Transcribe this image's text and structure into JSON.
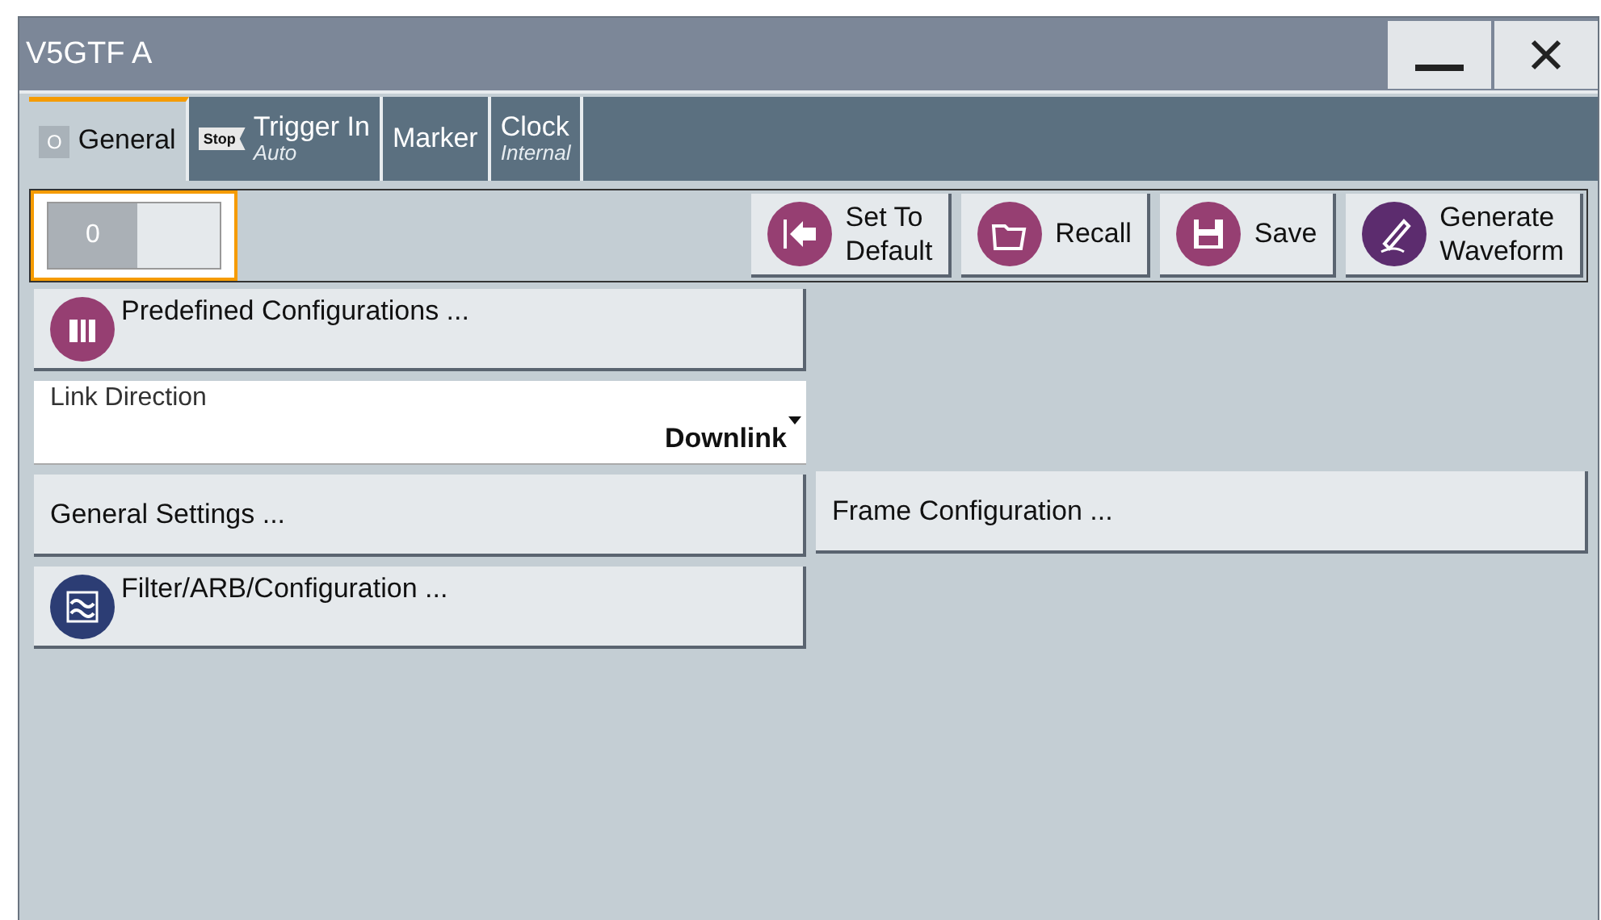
{
  "window": {
    "title": "V5GTF A",
    "controls": [
      {
        "kind": "minimize"
      },
      {
        "kind": "close"
      }
    ]
  },
  "tabs": [
    {
      "label": "General",
      "indicator": "O",
      "selected": true
    },
    {
      "label": "Trigger In",
      "badge": "Stop",
      "sublabel": "Auto",
      "selected": false
    },
    {
      "label": "Marker",
      "selected": false
    },
    {
      "label": "Clock",
      "sublabel": "Internal",
      "selected": false
    }
  ],
  "state_toggle": {
    "label": "0",
    "on": false
  },
  "toolbar": [
    {
      "label": "Set To\nDefault",
      "kind": "arrow"
    },
    {
      "label": "Recall",
      "kind": "folder"
    },
    {
      "label": "Save",
      "kind": "disk"
    },
    {
      "label": "Generate\nWaveform",
      "kind": "pen"
    }
  ],
  "left_items": [
    {
      "kind": "box",
      "label": "Predefined Configurations ..."
    },
    {
      "kind": "dropdown",
      "label": "Link Direction",
      "value": "Downlink"
    },
    {
      "kind": "button",
      "label": "General Settings ..."
    },
    {
      "kind": "filter",
      "label": "Filter/ARB/Configuration ..."
    }
  ],
  "right_items": [
    {
      "kind": "button",
      "label": "Frame Configuration ..."
    }
  ]
}
